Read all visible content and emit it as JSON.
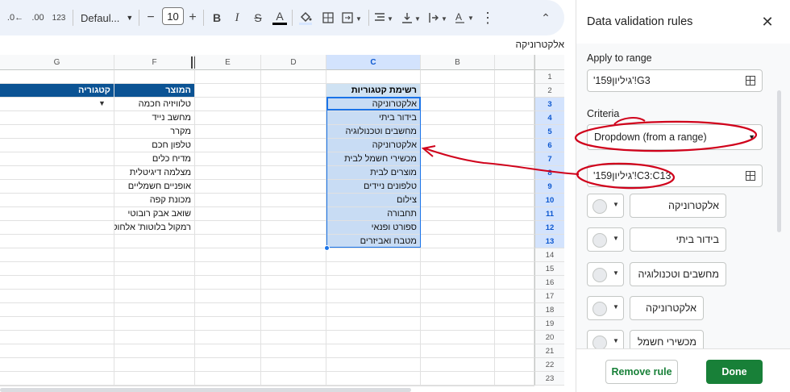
{
  "toolbar": {
    "decrease_decimal_label": ".0←",
    "increase_decimal_label": ".00",
    "number_format_label": "123",
    "font_name": "Defaul...",
    "font_size": "10",
    "minus_label": "−",
    "plus_label": "+"
  },
  "formula_bar": {
    "value": "אלקטרוניקה"
  },
  "columns": [
    "G",
    "F",
    "E",
    "D",
    "C",
    "B"
  ],
  "rows": [
    "1",
    "2",
    "3",
    "4",
    "5",
    "6",
    "7",
    "8",
    "9",
    "10",
    "11",
    "12",
    "13",
    "14",
    "15",
    "16",
    "17",
    "18",
    "19",
    "20",
    "21",
    "22",
    "23"
  ],
  "sheet": {
    "g_header": "קטגוריה",
    "f_header": "המוצר",
    "c_header": "רשימת קטגוריות",
    "products": [
      "טלוויזיה חכמה",
      "מחשב נייד",
      "מקרר",
      "טלפון חכם",
      "מדיח כלים",
      "מצלמה דיגיטלית",
      "אופניים חשמליים",
      "מכונת קפה",
      "שואב אבק רובוטי",
      "רמקול בלוטות' אלחוטי"
    ],
    "categories": [
      "אלקטרוניקה",
      "בידור ביתי",
      "מחשבים וטכנולוגיה",
      "אלקטרוניקה",
      "מכשירי חשמל לבית",
      "מוצרים לבית",
      "טלפונים ניידים",
      "צילום",
      "תחבורה",
      "ספורט ופנאי",
      "מטבח ואביזרים"
    ]
  },
  "panel": {
    "title": "Data validation rules",
    "apply_label": "Apply to range",
    "apply_value": "'גיליון159'!G3",
    "criteria_label": "Criteria",
    "criteria_value": "Dropdown (from a range)",
    "range_value": "'גיליון159'!C3:C13",
    "items": [
      "אלקטרוניקה",
      "בידור ביתי",
      "מחשבים וטכנולוגיה",
      "אלקטרוניקה",
      "מכשירי חשמל לבית"
    ],
    "remove_label": "Remove rule",
    "done_label": "Done"
  },
  "colors": {
    "header_blue": "#0b5394",
    "selection": "#c8dcf4",
    "done_green": "#188038",
    "annotation_red": "#d0021b"
  }
}
